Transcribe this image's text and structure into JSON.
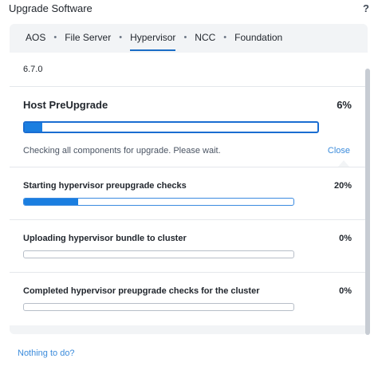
{
  "window": {
    "title": "Upgrade Software",
    "help_label": "?"
  },
  "tabs": [
    {
      "label": "AOS"
    },
    {
      "label": "File Server"
    },
    {
      "label": "Hypervisor"
    },
    {
      "label": "NCC"
    },
    {
      "label": "Foundation"
    }
  ],
  "active_tab": "Hypervisor",
  "tab_separator": "•",
  "version": "6.7.0",
  "host": {
    "title": "Host PreUpgrade",
    "percent_label": "6%",
    "progress": 0.06,
    "message": "Checking all components for upgrade. Please wait.",
    "close_label": "Close"
  },
  "steps": [
    {
      "label": "Starting hypervisor preupgrade checks",
      "percent_label": "20%",
      "progress": 0.2
    },
    {
      "label": "Uploading hypervisor bundle to cluster",
      "percent_label": "0%",
      "progress": 0.0
    },
    {
      "label": "Completed hypervisor preupgrade checks for the cluster",
      "percent_label": "0%",
      "progress": 0.0
    }
  ],
  "footer": {
    "link_label": "Nothing to do?"
  },
  "colors": {
    "accent": "#1a7ee0",
    "link": "#3b8bdb",
    "panel_bg": "#f2f4f6"
  }
}
